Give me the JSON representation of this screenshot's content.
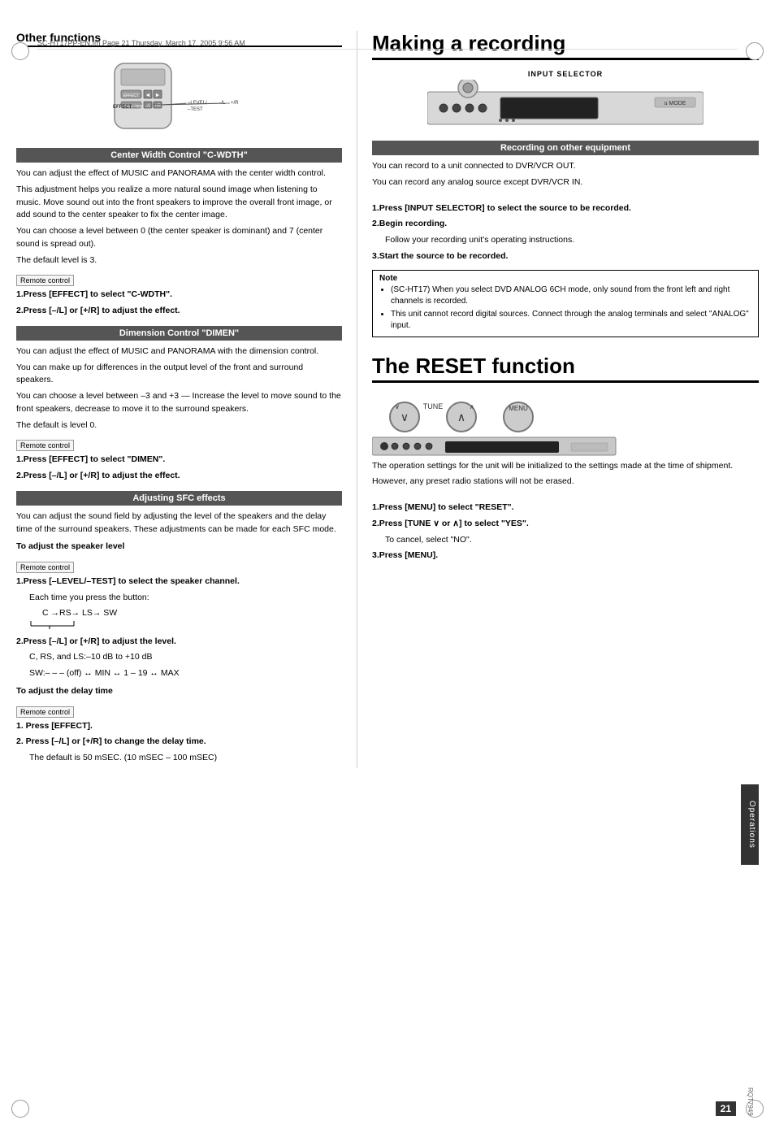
{
  "filepath": "SC-HT17PP-EN.fm  Page 21  Thursday, March 17, 2005  9:56 AM",
  "left_column": {
    "title": "Other functions",
    "sections": [
      {
        "id": "center-width",
        "header": "Center Width Control  \"C-WDTH\"",
        "paragraphs": [
          "You can adjust the effect of MUSIC and PANORAMA with the center width control.",
          "This adjustment helps you realize a more natural sound image when listening to music. Move sound out into the front  speakers to improve the overall front image, or add sound to the center speaker to fix the center image.",
          "You can choose a level between 0 (the center speaker is dominant) and 7 (center sound is spread out).",
          "The default level is 3."
        ],
        "remote_label": "Remote control",
        "steps": [
          "1.Press [EFFECT] to select \"C-WDTH\".",
          "2.Press [–/L] or [+/R] to adjust the effect."
        ]
      },
      {
        "id": "dimension",
        "header": "Dimension Control \"DIMEN\"",
        "paragraphs": [
          "You can adjust the effect of MUSIC and PANORAMA with the dimension control.",
          "You can make up for differences in the output level of the front and surround speakers.",
          "You can choose a level between –3 and +3 — Increase the level to move sound to the front speakers, decrease to move it to the surround speakers.",
          "The default is level 0."
        ],
        "remote_label": "Remote control",
        "steps": [
          "1.Press [EFFECT] to select \"DIMEN\".",
          "2.Press [–/L] or [+/R] to adjust the effect."
        ]
      },
      {
        "id": "sfc",
        "header": "Adjusting SFC effects",
        "intro": "You can adjust the sound field by adjusting the level of the speakers and the delay time of the surround speakers. These adjustments can be made for each SFC mode.",
        "subsections": [
          {
            "title": "To adjust the speaker level",
            "remote_label": "Remote control",
            "steps": [
              "1.Press [–LEVEL/–TEST] to select the speaker channel.",
              "Each time you press the button:",
              "2.Press [–/L] or [+/R] to adjust the level.",
              "C, RS, and LS:–10 dB to +10 dB",
              "SW:– – – (off) ↔ MIN ↔ 1 – 19 ↔ MAX"
            ],
            "chain": "C →RS→ LS→ SW"
          },
          {
            "title": "To adjust the delay time",
            "remote_label": "Remote control",
            "steps": [
              "1. Press [EFFECT].",
              "2. Press [–/L] or [+/R] to change the delay time.",
              "The default is 50 mSEC. (10 mSEC  – 100 mSEC)"
            ]
          }
        ]
      }
    ]
  },
  "right_column": {
    "making_recording": {
      "title": "Making a recording",
      "input_selector_label": "INPUT SELECTOR",
      "section_header": "Recording on other equipment",
      "paragraphs": [
        "You can record to a unit connected to DVR/VCR OUT.",
        "You can record any analog source except DVR/VCR IN."
      ],
      "steps": [
        "1.Press [INPUT SELECTOR] to select the source to be recorded.",
        "2.Begin recording.",
        "Follow your recording unit's operating instructions.",
        "3.Start the source to be recorded."
      ],
      "note": {
        "title": "Note",
        "items": [
          "(SC-HT17) When you select DVD ANALOG 6CH mode, only sound from the front left and right channels is recorded.",
          "This unit cannot record digital sources. Connect through the analog terminals and select \"ANALOG\" input."
        ]
      }
    },
    "reset_function": {
      "title": "The RESET function",
      "tune_label": "TUNE",
      "menu_label": "MENU",
      "paragraphs": [
        "The operation settings for the unit will be initialized to the settings made at the time of shipment.",
        "However, any preset radio stations will not be erased."
      ],
      "steps": [
        "1.Press [MENU] to select \"RESET\".",
        "2.Press [TUNE ∨ or ∧] to select \"YES\".",
        "To cancel, select \"NO\".",
        "3.Press [MENU]."
      ]
    }
  },
  "page_number": "21",
  "doc_id": "RQT7949",
  "operations_label": "Operations"
}
